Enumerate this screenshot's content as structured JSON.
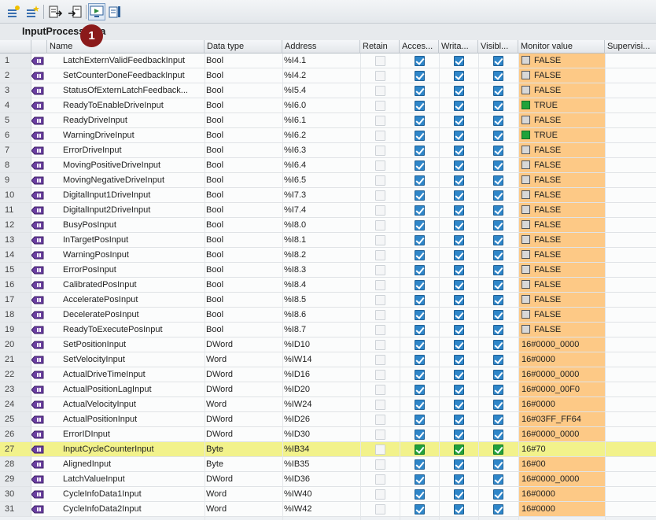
{
  "toolbar": {
    "buttons": [
      {
        "icon": "add-tag-icon"
      },
      {
        "icon": "add-tag-star-icon"
      },
      {
        "icon": "export-icon"
      },
      {
        "icon": "import-icon"
      },
      {
        "icon": "monitor-all-icon"
      },
      {
        "icon": "preserve-values-icon"
      }
    ]
  },
  "table": {
    "title": "InputProcessData",
    "badge": "1",
    "headers": {
      "name": "Name",
      "datatype": "Data type",
      "address": "Address",
      "retain": "Retain",
      "accessible": "Acces...",
      "writable": "Writa...",
      "visible": "Visibl...",
      "monitor": "Monitor value",
      "supervision": "Supervisi..."
    },
    "rows": [
      {
        "num": "1",
        "name": "LatchExternValidFeedbackInput",
        "type": "Bool",
        "address": "%I4.1",
        "monitor": "FALSE",
        "bool": "false"
      },
      {
        "num": "2",
        "name": "SetCounterDoneFeedbackInput",
        "type": "Bool",
        "address": "%I4.2",
        "monitor": "FALSE",
        "bool": "false"
      },
      {
        "num": "3",
        "name": "StatusOfExternLatchFeedback...",
        "type": "Bool",
        "address": "%I5.4",
        "monitor": "FALSE",
        "bool": "false"
      },
      {
        "num": "4",
        "name": "ReadyToEnableDriveInput",
        "type": "Bool",
        "address": "%I6.0",
        "monitor": "TRUE",
        "bool": "true"
      },
      {
        "num": "5",
        "name": "ReadyDriveInput",
        "type": "Bool",
        "address": "%I6.1",
        "monitor": "FALSE",
        "bool": "false"
      },
      {
        "num": "6",
        "name": "WarningDriveInput",
        "type": "Bool",
        "address": "%I6.2",
        "monitor": "TRUE",
        "bool": "true"
      },
      {
        "num": "7",
        "name": "ErrorDriveInput",
        "type": "Bool",
        "address": "%I6.3",
        "monitor": "FALSE",
        "bool": "false"
      },
      {
        "num": "8",
        "name": "MovingPositiveDriveInput",
        "type": "Bool",
        "address": "%I6.4",
        "monitor": "FALSE",
        "bool": "false"
      },
      {
        "num": "9",
        "name": "MovingNegativeDriveInput",
        "type": "Bool",
        "address": "%I6.5",
        "monitor": "FALSE",
        "bool": "false"
      },
      {
        "num": "10",
        "name": "DigitalInput1DriveInput",
        "type": "Bool",
        "address": "%I7.3",
        "monitor": "FALSE",
        "bool": "false"
      },
      {
        "num": "11",
        "name": "DigitalInput2DriveInput",
        "type": "Bool",
        "address": "%I7.4",
        "monitor": "FALSE",
        "bool": "false"
      },
      {
        "num": "12",
        "name": "BusyPosInput",
        "type": "Bool",
        "address": "%I8.0",
        "monitor": "FALSE",
        "bool": "false"
      },
      {
        "num": "13",
        "name": "InTargetPosInput",
        "type": "Bool",
        "address": "%I8.1",
        "monitor": "FALSE",
        "bool": "false"
      },
      {
        "num": "14",
        "name": "WarningPosInput",
        "type": "Bool",
        "address": "%I8.2",
        "monitor": "FALSE",
        "bool": "false"
      },
      {
        "num": "15",
        "name": "ErrorPosInput",
        "type": "Bool",
        "address": "%I8.3",
        "monitor": "FALSE",
        "bool": "false"
      },
      {
        "num": "16",
        "name": "CalibratedPosInput",
        "type": "Bool",
        "address": "%I8.4",
        "monitor": "FALSE",
        "bool": "false"
      },
      {
        "num": "17",
        "name": "AcceleratePosInput",
        "type": "Bool",
        "address": "%I8.5",
        "monitor": "FALSE",
        "bool": "false"
      },
      {
        "num": "18",
        "name": "DeceleratePosInput",
        "type": "Bool",
        "address": "%I8.6",
        "monitor": "FALSE",
        "bool": "false"
      },
      {
        "num": "19",
        "name": "ReadyToExecutePosInput",
        "type": "Bool",
        "address": "%I8.7",
        "monitor": "FALSE",
        "bool": "false"
      },
      {
        "num": "20",
        "name": "SetPositionInput",
        "type": "DWord",
        "address": "%ID10",
        "monitor": "16#0000_0000",
        "bool": ""
      },
      {
        "num": "21",
        "name": "SetVelocityInput",
        "type": "Word",
        "address": "%IW14",
        "monitor": "16#0000",
        "bool": ""
      },
      {
        "num": "22",
        "name": "ActualDriveTimeInput",
        "type": "DWord",
        "address": "%ID16",
        "monitor": "16#0000_0000",
        "bool": ""
      },
      {
        "num": "23",
        "name": "ActualPositionLagInput",
        "type": "DWord",
        "address": "%ID20",
        "monitor": "16#0000_00F0",
        "bool": ""
      },
      {
        "num": "24",
        "name": "ActualVelocityInput",
        "type": "Word",
        "address": "%IW24",
        "monitor": "16#0000",
        "bool": ""
      },
      {
        "num": "25",
        "name": "ActualPositionInput",
        "type": "DWord",
        "address": "%ID26",
        "monitor": "16#03FF_FF64",
        "bool": ""
      },
      {
        "num": "26",
        "name": "ErrorIDInput",
        "type": "DWord",
        "address": "%ID30",
        "monitor": "16#0000_0000",
        "bool": ""
      },
      {
        "num": "27",
        "name": "InputCycleCounterInput",
        "type": "Byte",
        "address": "%IB34",
        "monitor": "16#70",
        "bool": "",
        "highlight": true
      },
      {
        "num": "28",
        "name": "AlignedInput",
        "type": "Byte",
        "address": "%IB35",
        "monitor": "16#00",
        "bool": ""
      },
      {
        "num": "29",
        "name": "LatchValueInput",
        "type": "DWord",
        "address": "%ID36",
        "monitor": "16#0000_0000",
        "bool": ""
      },
      {
        "num": "30",
        "name": "CycleInfoData1Input",
        "type": "Word",
        "address": "%IW40",
        "monitor": "16#0000",
        "bool": ""
      },
      {
        "num": "31",
        "name": "CycleInfoData2Input",
        "type": "Word",
        "address": "%IW42",
        "monitor": "16#0000",
        "bool": ""
      }
    ]
  }
}
